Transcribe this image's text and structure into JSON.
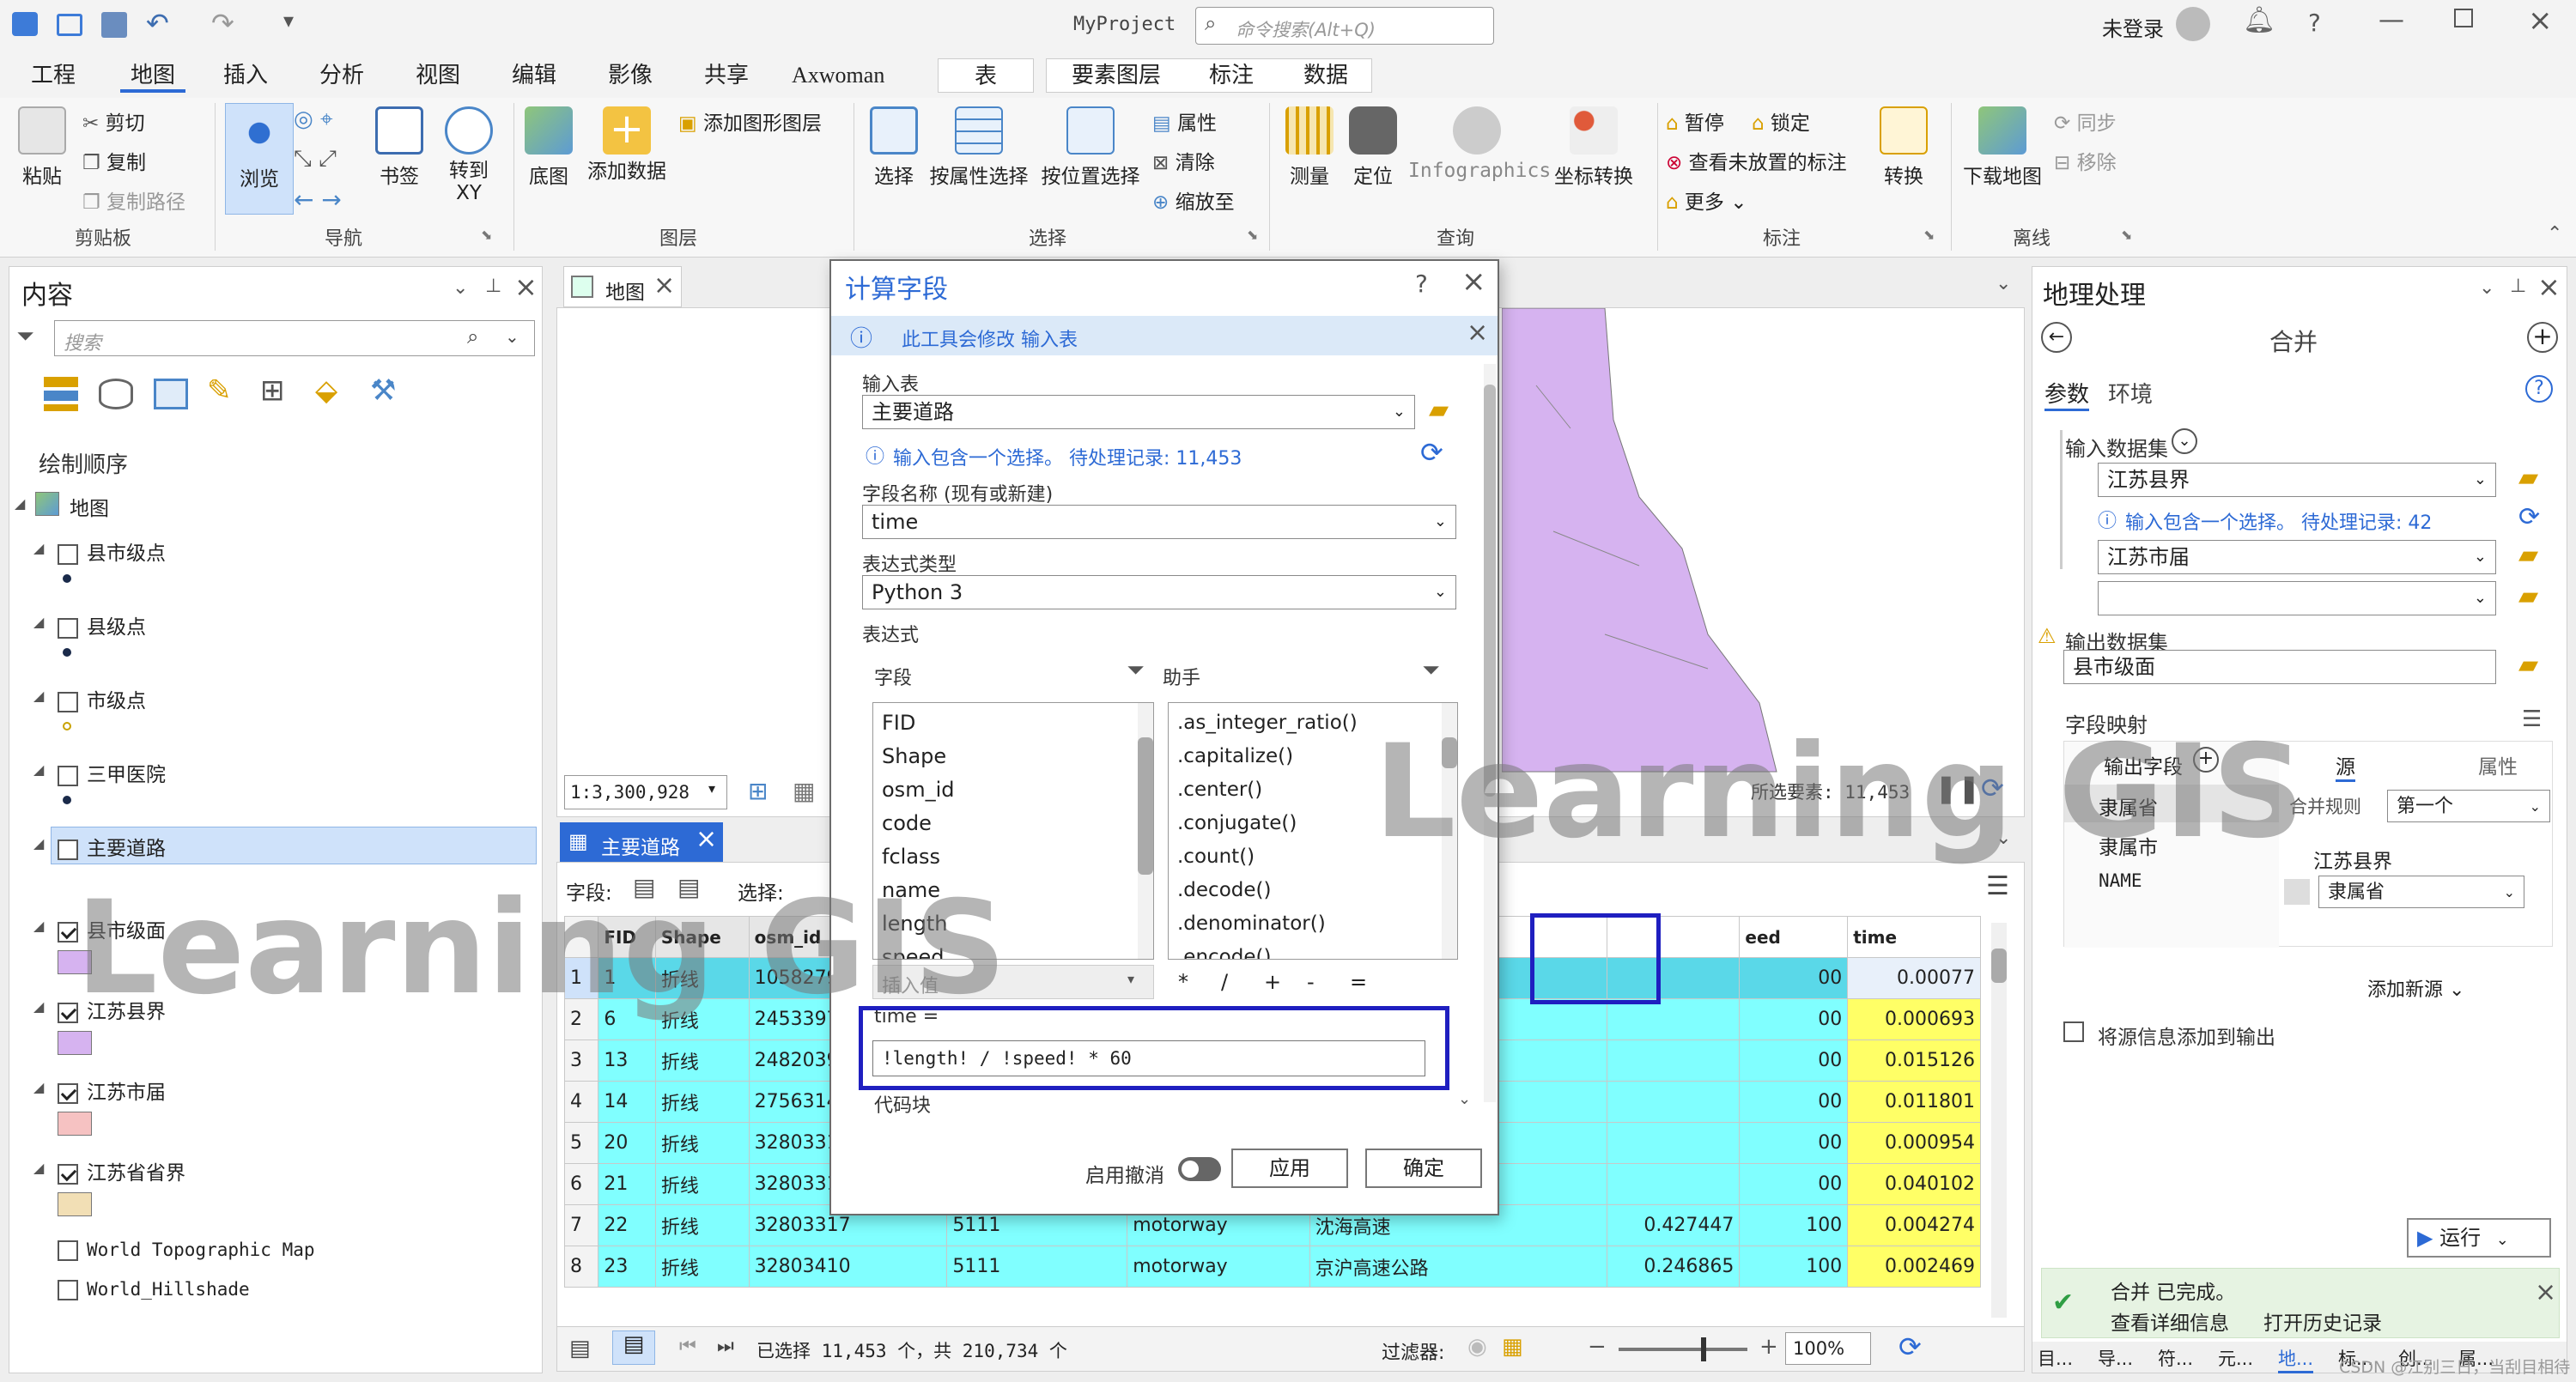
{
  "app": {
    "project": "MyProject",
    "search_placeholder": "命令搜索(Alt+Q)",
    "user": "未登录"
  },
  "tabs": [
    "工程",
    "地图",
    "插入",
    "分析",
    "视图",
    "编辑",
    "影像",
    "共享",
    "Axwoman",
    "表",
    "要素图层",
    "标注",
    "数据"
  ],
  "ribbon": {
    "clipboard": {
      "paste": "粘贴",
      "cut": "剪切",
      "copy": "复制",
      "copy_path": "复制路径",
      "group": "剪贴板"
    },
    "navigate": {
      "explore": "浏览",
      "bookmarks": "书签",
      "goto": "转到\nXY",
      "group": "导航"
    },
    "layer": {
      "basemap": "底图",
      "add_data": "添加数据",
      "add_graphics": "添加图形图层",
      "group": "图层"
    },
    "selection": {
      "select": "选择",
      "by_attr": "按属性选择",
      "by_loc": "按位置选择",
      "attributes": "属性",
      "clear": "清除",
      "zoom_to": "缩放至",
      "group": "选择"
    },
    "inquiry": {
      "measure": "测量",
      "locate": "定位",
      "infographics": "Infographics",
      "coord": "坐标转换",
      "group": "查询"
    },
    "labeling": {
      "pause": "暂停",
      "lock": "锁定",
      "unplaced": "查看未放置的标注",
      "more": "更多",
      "convert": "转换",
      "group": "标注"
    },
    "offline": {
      "download": "下载地图",
      "sync": "同步",
      "remove": "移除",
      "group": "离线"
    }
  },
  "contents": {
    "title": "内容",
    "search_placeholder": "搜索",
    "draw_order": "绘制顺序",
    "map": "地图",
    "layers": [
      {
        "name": "县市级点",
        "checked": false,
        "swatch": "dot"
      },
      {
        "name": "县级点",
        "checked": false,
        "swatch": "dot"
      },
      {
        "name": "市级点",
        "checked": false,
        "swatch": "ring"
      },
      {
        "name": "三甲医院",
        "checked": false,
        "swatch": "dot"
      },
      {
        "name": "主要道路",
        "checked": false,
        "swatch": "none",
        "selected": true
      },
      {
        "name": "县市级面",
        "checked": true,
        "swatch": "#d6b3f0"
      },
      {
        "name": "江苏县界",
        "checked": true,
        "swatch": "#d6b3f0"
      },
      {
        "name": "江苏市届",
        "checked": true,
        "swatch": "#f6c2c2"
      },
      {
        "name": "江苏省省界",
        "checked": true,
        "swatch": "#f2dfb5"
      },
      {
        "name": "World Topographic Map",
        "checked": false,
        "swatch": "none"
      },
      {
        "name": "World_Hillshade",
        "checked": false,
        "swatch": "none"
      }
    ]
  },
  "map_view": {
    "tab": "地图",
    "scale": "1:3,300,928",
    "selected": "所选要素: 11,453"
  },
  "attr_table": {
    "tab": "主要道路",
    "fields_label": "字段:",
    "select_label": "选择:",
    "headers": [
      "FID",
      "Shape",
      "osm_id",
      "",
      "",
      "",
      "",
      "eed",
      "time"
    ],
    "rows": [
      [
        "1",
        "1",
        "折线",
        "10582792",
        "",
        "",
        "",
        "",
        "00",
        "0.00077"
      ],
      [
        "2",
        "6",
        "折线",
        "24533974",
        "",
        "",
        "",
        "",
        "00",
        "0.000693"
      ],
      [
        "3",
        "13",
        "折线",
        "24820395",
        "",
        "",
        "",
        "",
        "00",
        "0.015126"
      ],
      [
        "4",
        "14",
        "折线",
        "27563144",
        "",
        "",
        "",
        "",
        "00",
        "0.011801"
      ],
      [
        "5",
        "20",
        "折线",
        "32803315",
        "",
        "",
        "",
        "",
        "00",
        "0.000954"
      ],
      [
        "6",
        "21",
        "折线",
        "32803316",
        "",
        "",
        "",
        "",
        "00",
        "0.040102"
      ],
      [
        "7",
        "22",
        "折线",
        "32803317",
        "5111",
        "motorway",
        "沈海高速",
        "0.427447",
        "100",
        "0.004274"
      ],
      [
        "8",
        "23",
        "折线",
        "32803410",
        "5111",
        "motorway",
        "京沪高速公路",
        "0.246865",
        "100",
        "0.002469"
      ]
    ],
    "status": "已选择 11,453 个，共 210,734 个",
    "filter": "过滤器:",
    "zoom": "100%"
  },
  "dialog": {
    "title": "计算字段",
    "info": "此工具会修改 输入表",
    "input_table_label": "输入表",
    "input_table": "主要道路",
    "selection_note": "输入包含一个选择。 待处理记录: 11,453",
    "field_name_label": "字段名称 (现有或新建)",
    "field_name": "time",
    "expr_type_label": "表达式类型",
    "expr_type": "Python 3",
    "expression_label": "表达式",
    "fields_label": "字段",
    "helpers_label": "助手",
    "fields": [
      "FID",
      "Shape",
      "osm_id",
      "code",
      "fclass",
      "name",
      "length",
      "speed"
    ],
    "helpers": [
      ".as_integer_ratio()",
      ".capitalize()",
      ".center()",
      ".conjugate()",
      ".count()",
      ".decode()",
      ".denominator()",
      ".encode()"
    ],
    "insert_value": "插入值",
    "operators": [
      "*",
      "/",
      "+",
      "-",
      "="
    ],
    "expr_target": "time =",
    "expression": "!length! / !speed! * 60",
    "code_block": "代码块",
    "undo_label": "启用撤消",
    "apply": "应用",
    "ok": "确定"
  },
  "geoprocessing": {
    "title": "地理处理",
    "tool": "合并",
    "tab_params": "参数",
    "tab_env": "环境",
    "input_label": "输入数据集",
    "inputs": [
      "江苏县界",
      "江苏市届",
      ""
    ],
    "selection_note": "输入包含一个选择。 待处理记录: 42",
    "output_label": "输出数据集",
    "output": "县市级面",
    "mapping_label": "字段映射",
    "out_fields_label": "输出字段",
    "source_label": "源",
    "prop_label": "属性",
    "out_fields": [
      "隶属省",
      "隶属市",
      "NAME"
    ],
    "merge_rule_label": "合并规则",
    "merge_rule": "第一个",
    "source_layer": "江苏县界",
    "source_field": "隶属省",
    "add_source": "添加新源",
    "add_info": "将源信息添加到输出",
    "run": "运行",
    "done": "合并 已完成。",
    "details": "查看详细信息",
    "history": "打开历史记录",
    "bottom_tabs": [
      "目...",
      "导...",
      "符...",
      "元...",
      "地...",
      "标...",
      "创...",
      "属..."
    ]
  },
  "watermark": "Learning GIS",
  "credit": "CSDN @江别三日，当刮目相待"
}
